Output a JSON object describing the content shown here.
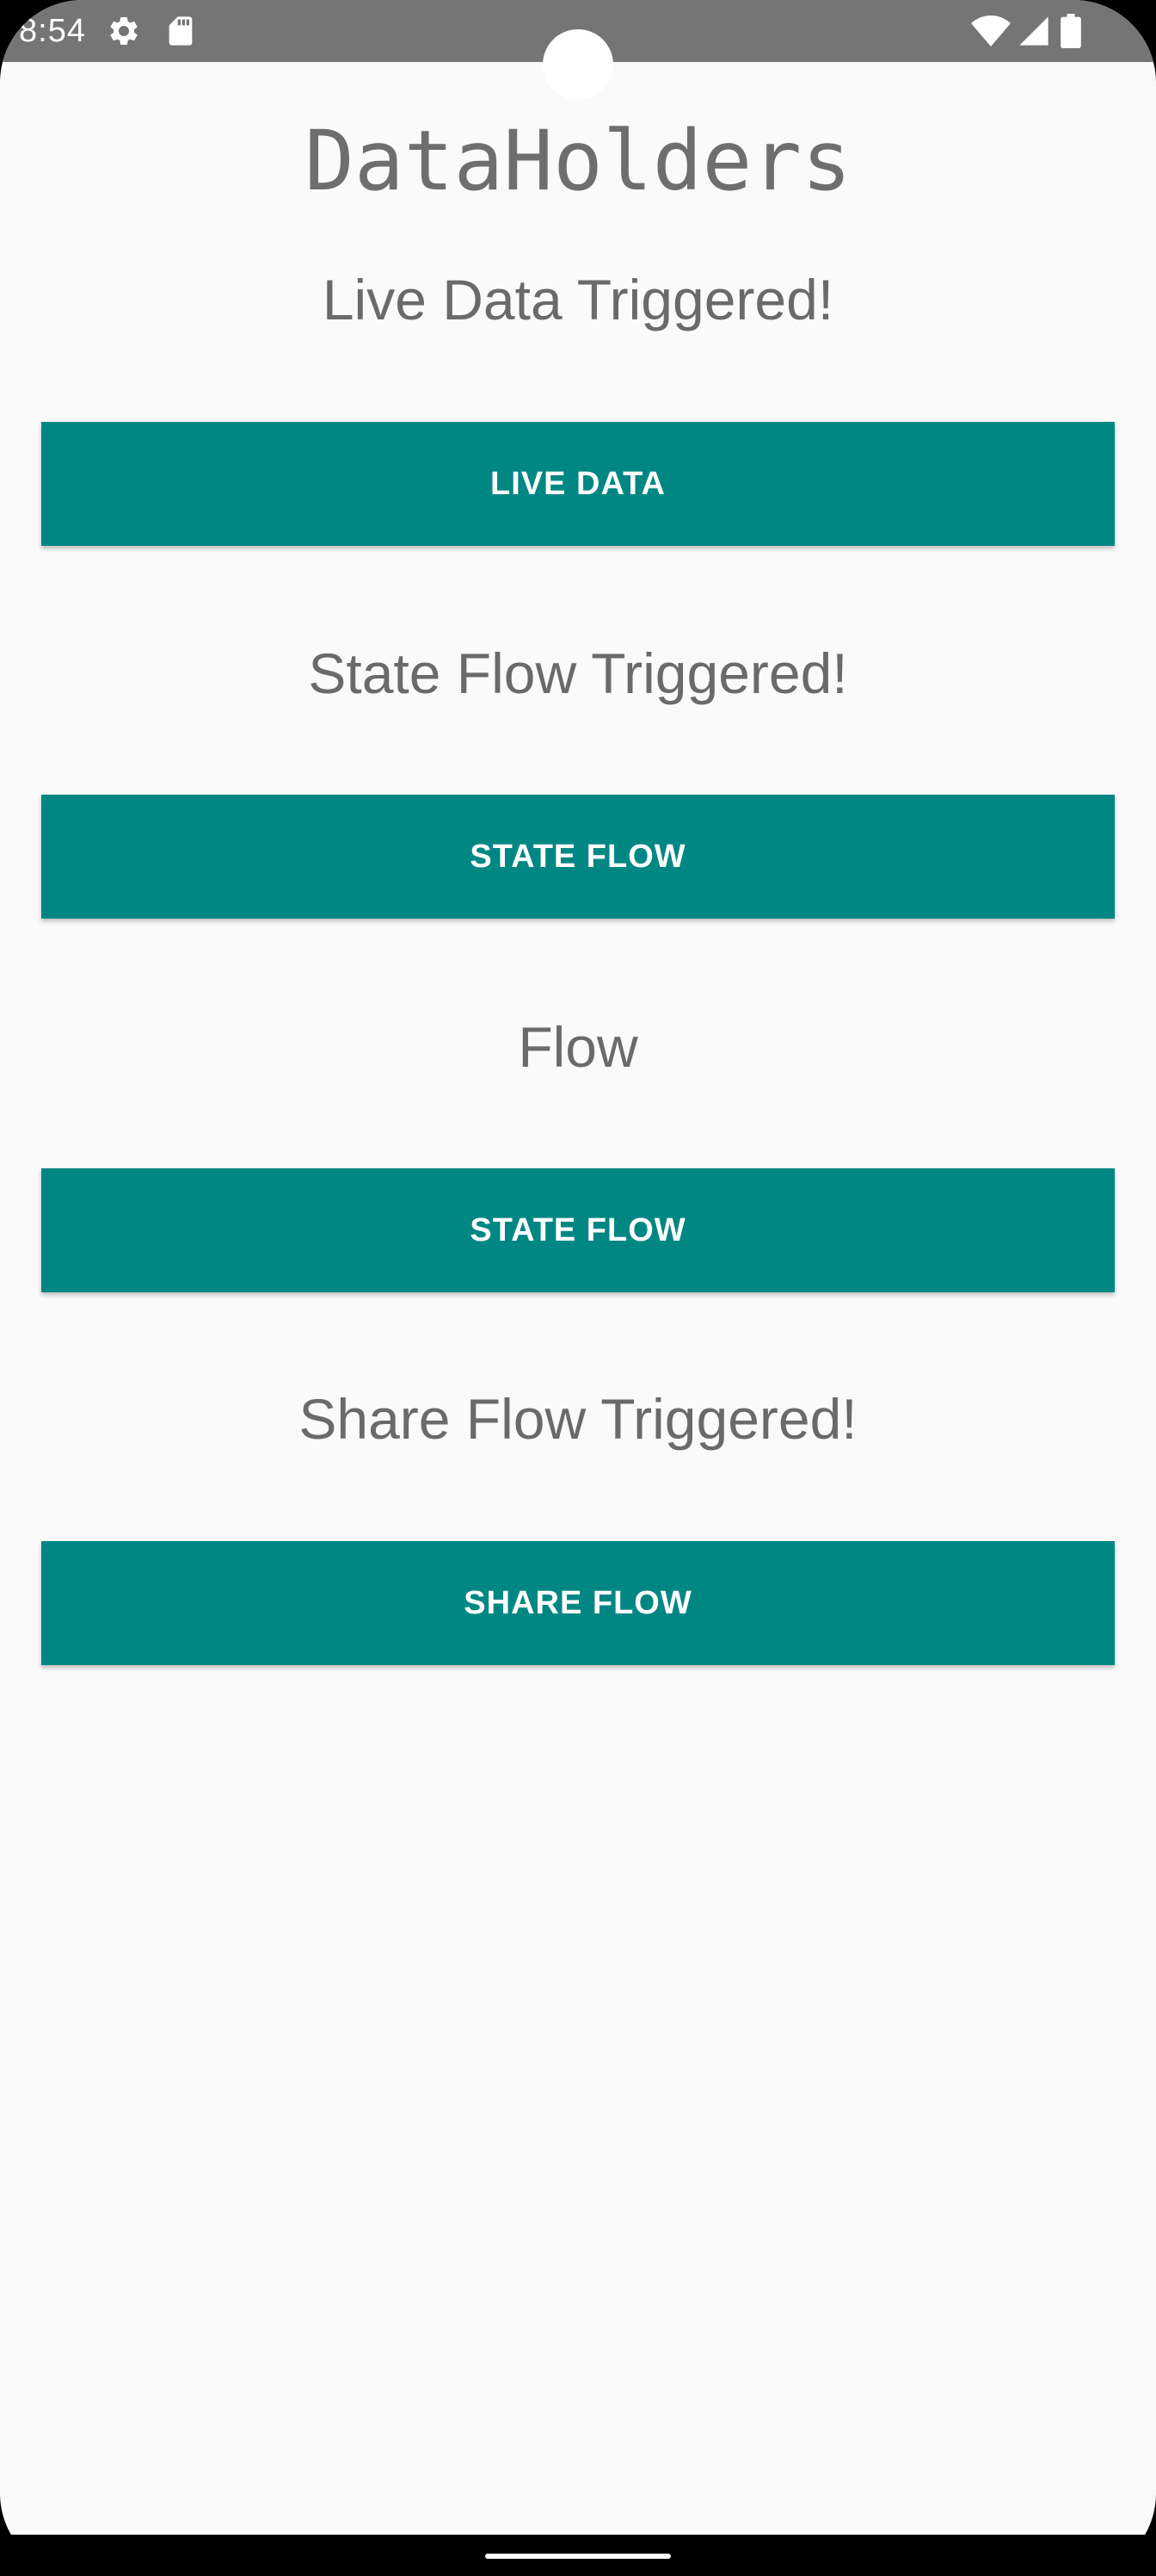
{
  "status_bar": {
    "time": "8:54",
    "icons": [
      "gear-icon",
      "sd-card-icon",
      "wifi-icon",
      "cell-signal-icon",
      "battery-icon"
    ]
  },
  "app": {
    "title": "DataHolders"
  },
  "sections": [
    {
      "label": "Live Data Triggered!",
      "button": "LIVE DATA"
    },
    {
      "label": "State Flow Triggered!",
      "button": "STATE FLOW"
    },
    {
      "label": "Flow",
      "button": "STATE FLOW"
    },
    {
      "label": "Share Flow Triggered!",
      "button": "SHARE FLOW"
    }
  ],
  "colors": {
    "button": "#008784",
    "status_bar": "#757575",
    "background": "#FAFAFA",
    "text": "#6A6A6A"
  }
}
